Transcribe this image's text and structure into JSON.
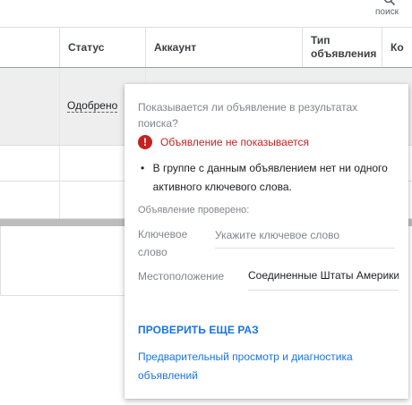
{
  "topbar": {
    "search_label": "поиск"
  },
  "table": {
    "columns": {
      "status": "Статус",
      "account": "Аккаунт",
      "ad_type": "Тип объявления",
      "ko": "Ко"
    },
    "rows": [
      {
        "status": "Одобрено"
      }
    ]
  },
  "popup": {
    "question": "Показывается ли объявление в результатах поиска?",
    "alert": "Объявление не показывается",
    "reason": "В группе с данным объявлением нет ни одного активного ключевого слова.",
    "checked_label": "Объявление проверено:",
    "keyword_label": "Ключевое слово",
    "keyword_placeholder": "Укажите ключевое слово",
    "location_label": "Местоположение",
    "location_value": "Соединенные Штаты Америки",
    "recheck_button": "ПРОВЕРИТЬ ЕЩЕ РАЗ",
    "preview_link": "Предварительный просмотр и диагностика объявлений"
  },
  "colors": {
    "accent": "#1a73e8",
    "error": "#c5221f"
  },
  "icons": {
    "search": "search-icon",
    "alert": "error-icon"
  }
}
